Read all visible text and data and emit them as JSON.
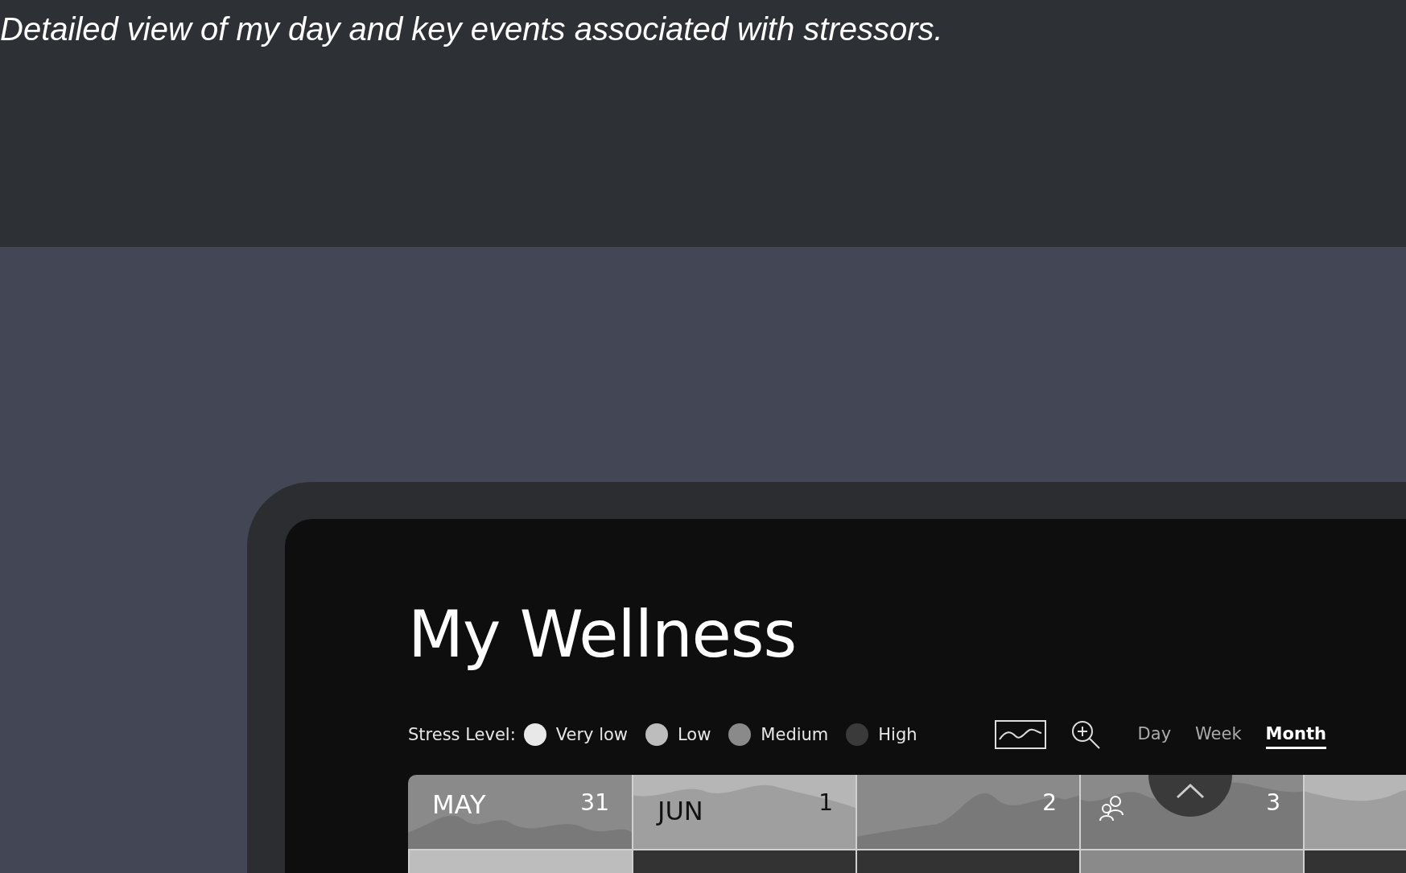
{
  "caption": "Detailed view of my day and key events associated with stressors.",
  "app": {
    "title": "My Wellness",
    "legend": {
      "label": "Stress Level:",
      "items": [
        {
          "label": "Very low",
          "color": "#e8e8e8"
        },
        {
          "label": "Low",
          "color": "#bdbdbd"
        },
        {
          "label": "Medium",
          "color": "#8a8a8a"
        },
        {
          "label": "High",
          "color": "#3a3a3a"
        }
      ]
    },
    "tabs": [
      {
        "label": "Day",
        "selected": false
      },
      {
        "label": "Week",
        "selected": false
      },
      {
        "label": "Month",
        "selected": true
      }
    ],
    "calendar": {
      "days": [
        {
          "month": "MAY",
          "day": "31",
          "color": "#8a8a8a",
          "event": false
        },
        {
          "month": "JUN",
          "day": "1",
          "color": "#b6b6b6",
          "event": false
        },
        {
          "day": "2",
          "color": "#8a8a8a",
          "event": false
        },
        {
          "day": "3",
          "color": "#8a8a8a",
          "event": true
        },
        {
          "color": "#b6b6b6",
          "event": false
        }
      ],
      "next_row": [
        {
          "color": "#bdbdbd"
        },
        {
          "color": "#333333"
        },
        {
          "color": "#333333"
        },
        {
          "color": "#8a8a8a"
        },
        {
          "color": "#333333"
        }
      ]
    }
  }
}
